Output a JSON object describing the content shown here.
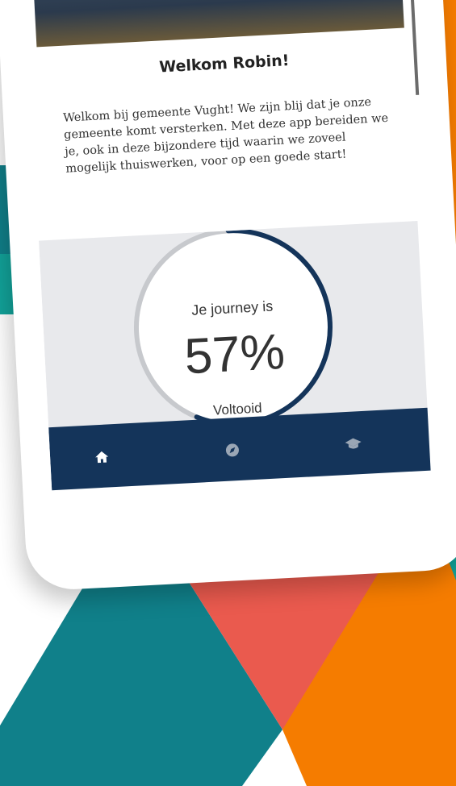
{
  "welcome": {
    "title": "Welkom Robin!",
    "body": "Welkom bij gemeente Vught! We zijn blij dat je onze gemeente komt versterken. Met deze app bereiden we je, ook in deze bijzondere tijd waarin we zoveel mogelijk thuiswerken, voor op een goede start!"
  },
  "progress": {
    "label": "Je journey is",
    "percent_text": "57%",
    "status": "Voltooid",
    "fraction": 0.57
  },
  "tabs": [
    {
      "icon": "home-icon"
    },
    {
      "icon": "compass-icon"
    },
    {
      "icon": "graduation-cap-icon"
    }
  ],
  "colors": {
    "navy": "#14345a",
    "teal": "#10808a",
    "orange": "#f57c00",
    "coral": "#ea5a4e",
    "yellow": "#f5cc4e",
    "progress_track": "#c7c9cd"
  }
}
